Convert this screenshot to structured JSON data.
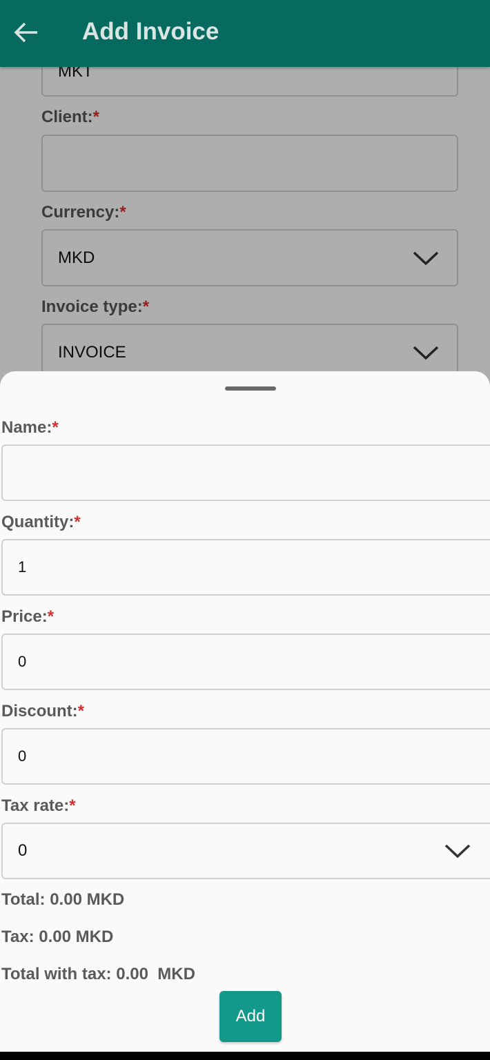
{
  "appbar": {
    "title": "Add Invoice",
    "back_icon": "arrow-left-icon"
  },
  "background_form": {
    "partial_value": "MKT",
    "client": {
      "label": "Client:",
      "required_mark": "*",
      "value": ""
    },
    "currency": {
      "label": "Currency:",
      "required_mark": "*",
      "value": "MKD"
    },
    "invoice_type": {
      "label": "Invoice type:",
      "required_mark": "*",
      "value": "INVOICE"
    }
  },
  "sheet": {
    "name": {
      "label": "Name:",
      "required_mark": "*",
      "value": ""
    },
    "quantity": {
      "label": "Quantity:",
      "required_mark": "*",
      "value": "1"
    },
    "price": {
      "label": "Price:",
      "required_mark": "*",
      "value": "0"
    },
    "discount": {
      "label": "Discount:",
      "required_mark": "*",
      "value": "0"
    },
    "tax_rate": {
      "label": "Tax rate:",
      "required_mark": "*",
      "value": "0"
    },
    "total": "Total: 0.00 MKD",
    "tax": "Tax: 0.00 MKD",
    "total_with_tax": "Total with tax: 0.00  MKD",
    "add_label": "Add"
  },
  "colors": {
    "appbar": "#076a5f",
    "button": "#12998a",
    "required": "#d32f2f"
  }
}
